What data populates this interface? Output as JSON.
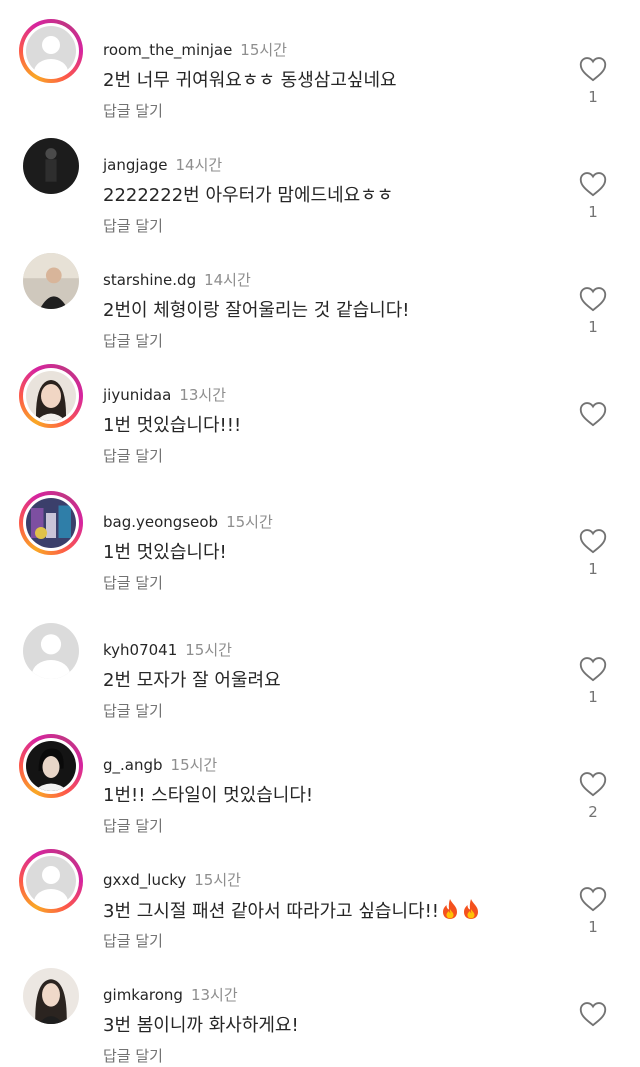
{
  "reply_label": "답글 달기",
  "comments": [
    {
      "username": "room_the_minjae",
      "time": "15시간",
      "text": "2번 너무 귀여워요ㅎㅎ 동생삼고싶네요",
      "likes": "1",
      "avatar": "default-avatar",
      "story_ring": true
    },
    {
      "username": "jangjage",
      "time": "14시간",
      "text": "2222222번 아우터가 맘에드네요ㅎㅎ",
      "likes": "1",
      "avatar": "dark-photo-avatar",
      "story_ring": false
    },
    {
      "username": "starshine.dg",
      "time": "14시간",
      "text": "2번이 체형이랑 잘어울리는 것 같습니다!",
      "likes": "1",
      "avatar": "person-photo-avatar",
      "story_ring": false
    },
    {
      "username": "jiyunidaa",
      "time": "13시간",
      "text": "1번 멋있습니다!!!",
      "likes": "",
      "avatar": "person-photo-avatar",
      "story_ring": true
    },
    {
      "username": "bag.yeongseob",
      "time": "15시간",
      "text": "1번 멋있습니다!",
      "likes": "1",
      "avatar": "colorful-photo-avatar",
      "story_ring": true
    },
    {
      "username": "kyh07041",
      "time": "15시간",
      "text": "2번 모자가 잘 어울려요",
      "likes": "1",
      "avatar": "default-avatar",
      "story_ring": false
    },
    {
      "username": "g_.angb",
      "time": "15시간",
      "text": "1번!! 스타일이 멋있습니다!",
      "likes": "2",
      "avatar": "person-photo-avatar",
      "story_ring": true
    },
    {
      "username": "gxxd_lucky",
      "time": "15시간",
      "text": "3번 그시절 패션 같아서 따라가고 싶습니다!!",
      "emoji": "fire-icon",
      "likes": "1",
      "avatar": "default-avatar",
      "story_ring": true
    },
    {
      "username": "gimkarong",
      "time": "13시간",
      "text": "3번 봄이니까 화사하게요!",
      "likes": "",
      "avatar": "person-photo-avatar",
      "story_ring": false
    }
  ]
}
